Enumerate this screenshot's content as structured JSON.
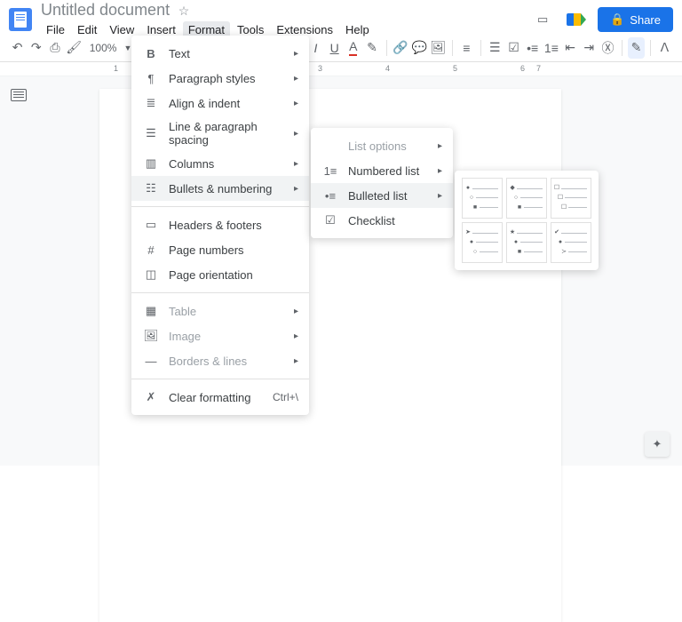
{
  "header": {
    "title": "Untitled document",
    "share": "Share"
  },
  "menubar": [
    "File",
    "Edit",
    "View",
    "Insert",
    "Format",
    "Tools",
    "Extensions",
    "Help"
  ],
  "toolbar": {
    "zoom": "100%"
  },
  "ruler": [
    "1",
    "3",
    "4",
    "5",
    "6",
    "7"
  ],
  "formatMenu": {
    "text": "Text",
    "paragraphStyles": "Paragraph styles",
    "alignIndent": "Align & indent",
    "lineSpacing": "Line & paragraph spacing",
    "columns": "Columns",
    "bulletsNumbering": "Bullets & numbering",
    "headersFooters": "Headers & footers",
    "pageNumbers": "Page numbers",
    "pageOrientation": "Page orientation",
    "table": "Table",
    "image": "Image",
    "bordersLines": "Borders & lines",
    "clearFormatting": "Clear formatting",
    "clearShortcut": "Ctrl+\\"
  },
  "bulletsSubmenu": {
    "listOptions": "List options",
    "numberedList": "Numbered list",
    "bulletedList": "Bulleted list",
    "checklist": "Checklist"
  }
}
